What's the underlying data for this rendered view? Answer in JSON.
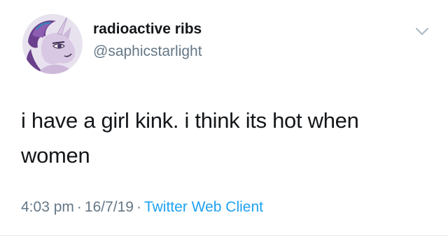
{
  "tweet": {
    "author": {
      "display_name": "radioactive ribs",
      "handle": "@saphicstarlight",
      "avatar_icon": "pony-avatar-icon"
    },
    "menu_icon": "chevron-down-icon",
    "text_lines": [
      "i have a girl kink. i think its hot when",
      "women"
    ],
    "timestamp": {
      "time": "4:03 pm",
      "separator": "·",
      "date": "16/7/19",
      "client": "Twitter Web Client"
    }
  },
  "colors": {
    "text": "#14171a",
    "secondary": "#657786",
    "link": "#1da1f2"
  }
}
